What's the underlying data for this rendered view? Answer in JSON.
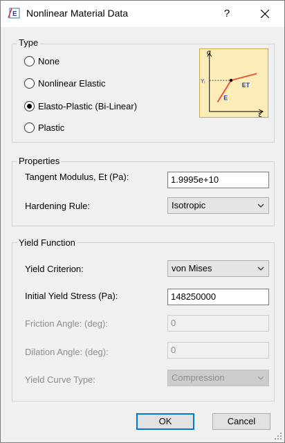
{
  "window": {
    "title": "Nonlinear Material Data",
    "help_label": "?"
  },
  "type_group": {
    "label": "Type",
    "options": [
      {
        "label": "None",
        "selected": false
      },
      {
        "label": "Nonlinear Elastic",
        "selected": false
      },
      {
        "label": "Elasto-Plastic (Bi-Linear)",
        "selected": true
      },
      {
        "label": "Plastic",
        "selected": false
      }
    ],
    "graph": {
      "y_axis": "σ",
      "x_axis": "ε",
      "yield_label": "Yᵢ",
      "slope_e": "E",
      "slope_et": "ET"
    }
  },
  "properties": {
    "label": "Properties",
    "tangent_modulus_label": "Tangent Modulus, Et (Pa):",
    "tangent_modulus_value": "1.9995e+10",
    "hardening_rule_label": "Hardening Rule:",
    "hardening_rule_value": "Isotropic"
  },
  "yield_function": {
    "label": "Yield Function",
    "criterion_label": "Yield Criterion:",
    "criterion_value": "von Mises",
    "initial_yield_label": "Initial Yield Stress (Pa):",
    "initial_yield_value": "148250000",
    "friction_label": "Friction Angle: (deg):",
    "friction_value": "0",
    "dilation_label": "Dilation Angle: (deg):",
    "dilation_value": "0",
    "curve_type_label": "Yield Curve Type:",
    "curve_type_value": "Compression"
  },
  "buttons": {
    "ok": "OK",
    "cancel": "Cancel"
  },
  "colors": {
    "accent": "#0078d7",
    "graph_bg": "#fcecb8",
    "graph_curve": "#e8563a",
    "graph_text": "#1f3fa8"
  }
}
